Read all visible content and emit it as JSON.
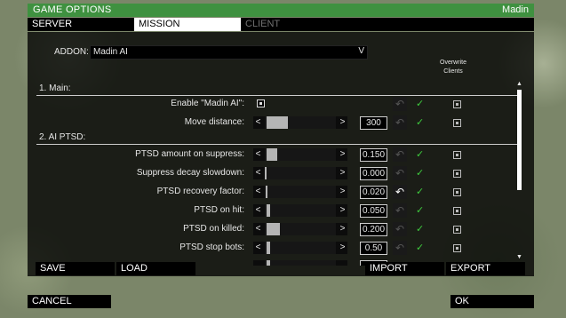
{
  "title": "GAME OPTIONS",
  "user": "Madin",
  "tabs": [
    "SERVER",
    "MISSION",
    "CLIENT"
  ],
  "addon": {
    "label": "ADDON:",
    "value": "Madin AI",
    "arrow": "V"
  },
  "overwrite_header": {
    "line1": "Overwrite",
    "line2": "Clients"
  },
  "sections": {
    "main": "1. Main:",
    "ptsd": "2. AI PTSD:"
  },
  "rows": [
    {
      "label": "Enable \"Madin AI\":",
      "type": "checkbox"
    },
    {
      "label": "Move distance:",
      "type": "slider",
      "value": "300",
      "level": 0.3
    },
    {
      "label": "PTSD amount on suppress:",
      "type": "slider",
      "value": "0.150",
      "level": 0.15
    },
    {
      "label": "Suppress decay slowdown:",
      "type": "slider",
      "value": "0.000",
      "level": 0.0
    },
    {
      "label": "PTSD recovery factor:",
      "type": "slider",
      "value": "0.020",
      "level": 0.02
    },
    {
      "label": "PTSD on hit:",
      "type": "slider",
      "value": "0.050",
      "level": 0.05
    },
    {
      "label": "PTSD on killed:",
      "type": "slider",
      "value": "0.200",
      "level": 0.2
    },
    {
      "label": "PTSD stop bots:",
      "type": "slider",
      "value": "0.50",
      "level": 0.05
    }
  ],
  "slider_arrows": {
    "less": "<",
    "more": ">"
  },
  "buttons": {
    "save": "SAVE",
    "load": "LOAD",
    "import": "IMPORT",
    "export": "EXPORT",
    "cancel": "CANCEL",
    "ok": "OK"
  },
  "colors": {
    "accent": "#3f9140",
    "check": "#3ecb3e"
  }
}
